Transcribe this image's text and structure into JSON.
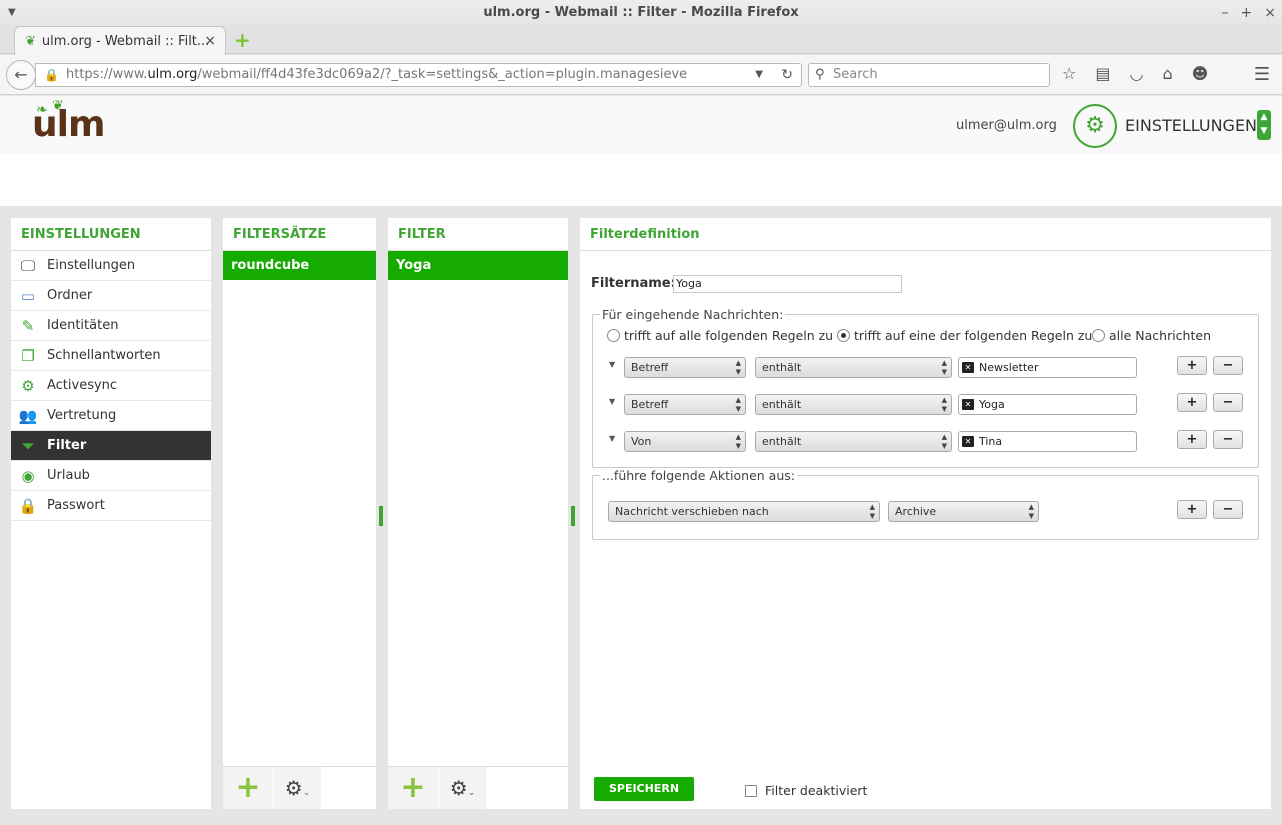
{
  "window": {
    "title": "ulm.org - Webmail :: Filter - Mozilla Firefox"
  },
  "tab": {
    "title": "ulm.org - Webmail :: Filt..."
  },
  "urlbar": {
    "prefix": "https://www.",
    "domain": "ulm.org",
    "path": "/webmail/ff4d43fe3dc069a2/?_task=settings&_action=plugin.managesieve"
  },
  "searchbar": {
    "placeholder": "Search"
  },
  "header": {
    "logo": "ulm",
    "username": "ulmer@ulm.org",
    "settings_label": "EINSTELLUNGEN"
  },
  "sidebar": {
    "title": "EINSTELLUNGEN",
    "items": [
      {
        "label": "Einstellungen",
        "icon": "monitor-icon"
      },
      {
        "label": "Ordner",
        "icon": "folder-icon"
      },
      {
        "label": "Identitäten",
        "icon": "identity-icon"
      },
      {
        "label": "Schnellantworten",
        "icon": "responses-icon"
      },
      {
        "label": "Activesync",
        "icon": "gear-icon"
      },
      {
        "label": "Vertretung",
        "icon": "users-icon"
      },
      {
        "label": "Filter",
        "icon": "funnel-icon",
        "active": true
      },
      {
        "label": "Urlaub",
        "icon": "vacation-icon"
      },
      {
        "label": "Passwort",
        "icon": "lock-icon"
      }
    ]
  },
  "filtersets": {
    "title": "FILTERSÄTZE",
    "items": [
      "roundcube"
    ]
  },
  "filters": {
    "title": "FILTER",
    "items": [
      "Yoga"
    ]
  },
  "definition": {
    "title": "Filterdefinition",
    "name_label": "Filtername:",
    "name_value": "Yoga",
    "incoming_legend": "Für eingehende Nachrichten:",
    "radios": [
      {
        "label": "trifft auf alle folgenden Regeln zu",
        "checked": false
      },
      {
        "label": "trifft auf eine der folgenden Regeln zu",
        "checked": true
      },
      {
        "label": "alle Nachrichten",
        "checked": false
      }
    ],
    "rules": [
      {
        "header": "Betreff",
        "op": "enthält",
        "value": "Newsletter"
      },
      {
        "header": "Betreff",
        "op": "enthält",
        "value": "Yoga"
      },
      {
        "header": "Von",
        "op": "enthält",
        "value": "Tina"
      }
    ],
    "actions_legend": "...führe folgende Aktionen aus:",
    "action": {
      "type": "Nachricht verschieben nach",
      "target": "Archive"
    },
    "save_label": "SPEICHERN",
    "disabled_label": "Filter deaktiviert"
  },
  "colors": {
    "accent": "#3fa535",
    "selected": "#16ab00"
  }
}
